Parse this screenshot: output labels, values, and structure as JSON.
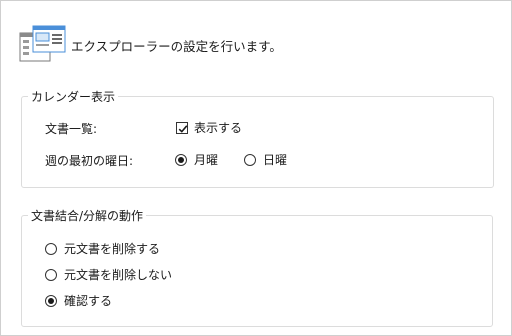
{
  "header": {
    "text": "エクスプローラーの設定を行います。",
    "icon": "explorer-settings-icon"
  },
  "calendar_group": {
    "title": "カレンダー表示",
    "doc_list_label": "文書一覧:",
    "show_checkbox": {
      "label": "表示する",
      "checked": true
    },
    "first_day_label": "週の最初の曜日:",
    "first_day_options": [
      {
        "label": "月曜",
        "selected": true
      },
      {
        "label": "日曜",
        "selected": false
      }
    ]
  },
  "merge_group": {
    "title": "文書結合/分解の動作",
    "options": [
      {
        "label": "元文書を削除する",
        "selected": false
      },
      {
        "label": "元文書を削除しない",
        "selected": false
      },
      {
        "label": "確認する",
        "selected": true
      }
    ]
  },
  "colors": {
    "accent": "#4a8fd9",
    "border": "#dcdcdc"
  }
}
